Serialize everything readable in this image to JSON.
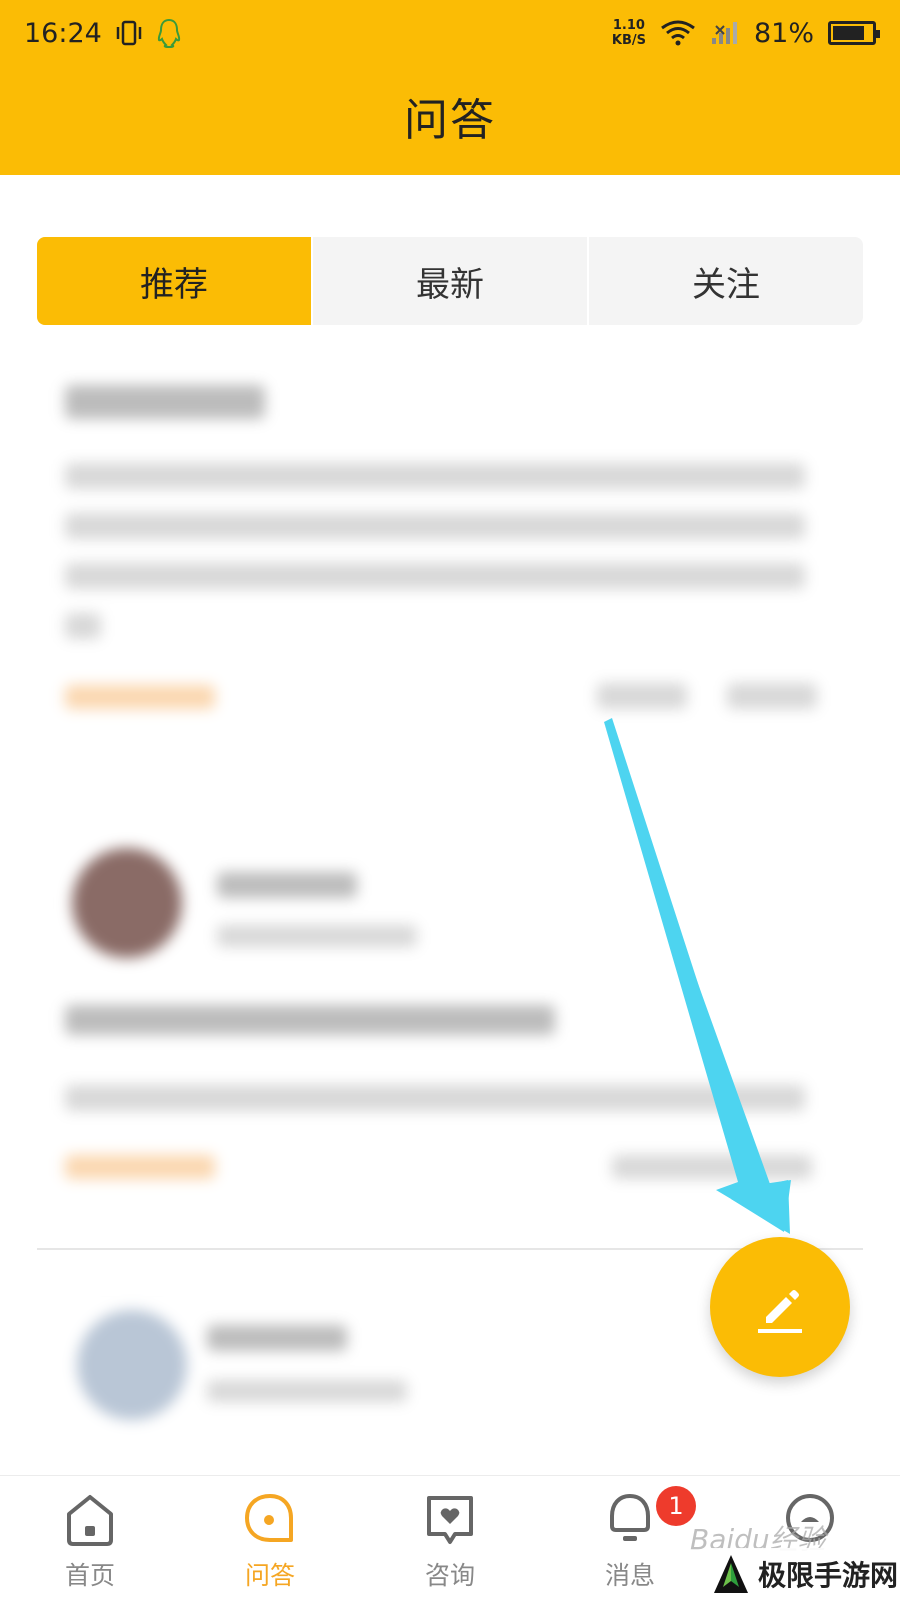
{
  "status_bar": {
    "time": "16:24",
    "net_speed_value": "1.10",
    "net_speed_unit": "KB/S",
    "battery": "81%",
    "battery_level": 0.81
  },
  "header": {
    "title": "问答"
  },
  "tabs": [
    {
      "label": "推荐",
      "active": true
    },
    {
      "label": "最新",
      "active": false
    },
    {
      "label": "关注",
      "active": false
    }
  ],
  "bottom_nav": [
    {
      "label": "首页",
      "icon": "home-icon",
      "active": false
    },
    {
      "label": "问答",
      "icon": "qa-icon",
      "active": true
    },
    {
      "label": "咨询",
      "icon": "consult-icon",
      "active": false
    },
    {
      "label": "消息",
      "icon": "bell-icon",
      "active": false,
      "badge": "1"
    },
    {
      "label": "",
      "icon": "profile-icon",
      "active": false
    }
  ],
  "fab": {
    "icon": "pencil-icon"
  },
  "watermarks": {
    "baidu": "Baidu经验",
    "site": "极限手游网"
  },
  "colors": {
    "accent": "#FBBC05",
    "badge": "#EE3B2C",
    "arrow": "#4DD4F0"
  }
}
